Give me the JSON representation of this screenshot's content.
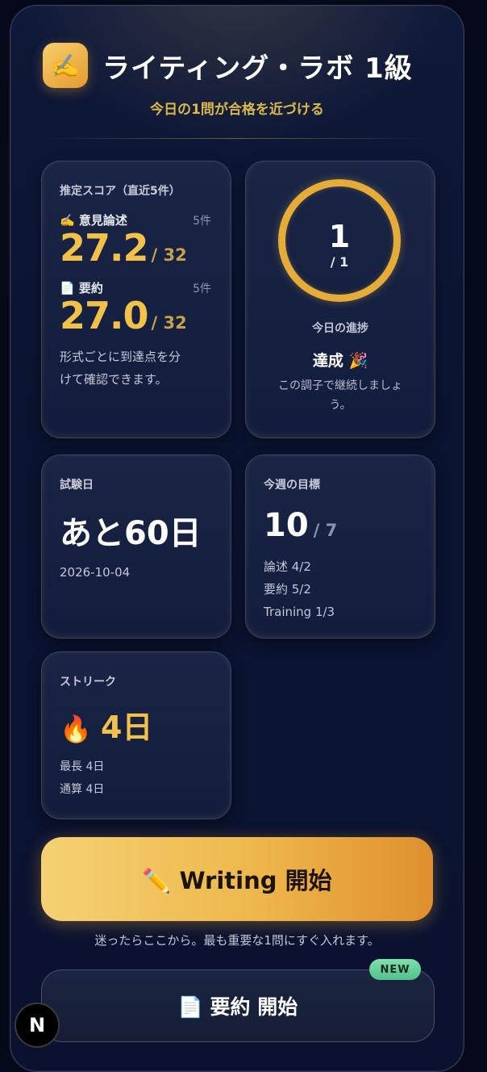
{
  "header": {
    "logo_icon": "✍️",
    "title": "ライティング・ラボ 1級",
    "subtitle": "今日の1問が合格を近づける"
  },
  "score_card": {
    "label": "推定スコア（直近5件）",
    "opinion": {
      "label": "✍️ 意見論述",
      "count": "5件",
      "score": "27.2",
      "max": "/ 32"
    },
    "summary": {
      "label": "📄 要約",
      "count": "5件",
      "score": "27.0",
      "max": "/ 32"
    },
    "note_line1": "形式ごとに到達点を分",
    "note_line2": "けて確認できます。"
  },
  "progress_card": {
    "done": "1",
    "total": "/ 1",
    "progress_fraction": 1.0,
    "label": "今日の進捗",
    "status": "達成 🎉",
    "message_line1": "この調子で継続しましょ",
    "message_line2": "う。"
  },
  "exam_card": {
    "label": "試験日",
    "countdown": "あと60日",
    "date": "2026-10-04"
  },
  "goal_card": {
    "label": "今週の目標",
    "value": "10",
    "target": "/ 7",
    "line1": "論述 4/2",
    "line2": "要約 5/2",
    "line3": "Training 1/3"
  },
  "streak_card": {
    "label": "ストリーク",
    "fire_icon": "🔥",
    "value": "4日",
    "longest": "最長 4日",
    "total": "通算 4日"
  },
  "actions": {
    "writing_button": "✏️ Writing 開始",
    "hint": "迷ったらここから。最も重要な1問にすぐ入れます。",
    "summary_button": "📄 要約 開始",
    "new_badge": "NEW"
  },
  "dev_badge": "N",
  "colors": {
    "accent_gold": "#f2c14a",
    "background": "#0a1430",
    "new_badge": "#52c08b"
  }
}
